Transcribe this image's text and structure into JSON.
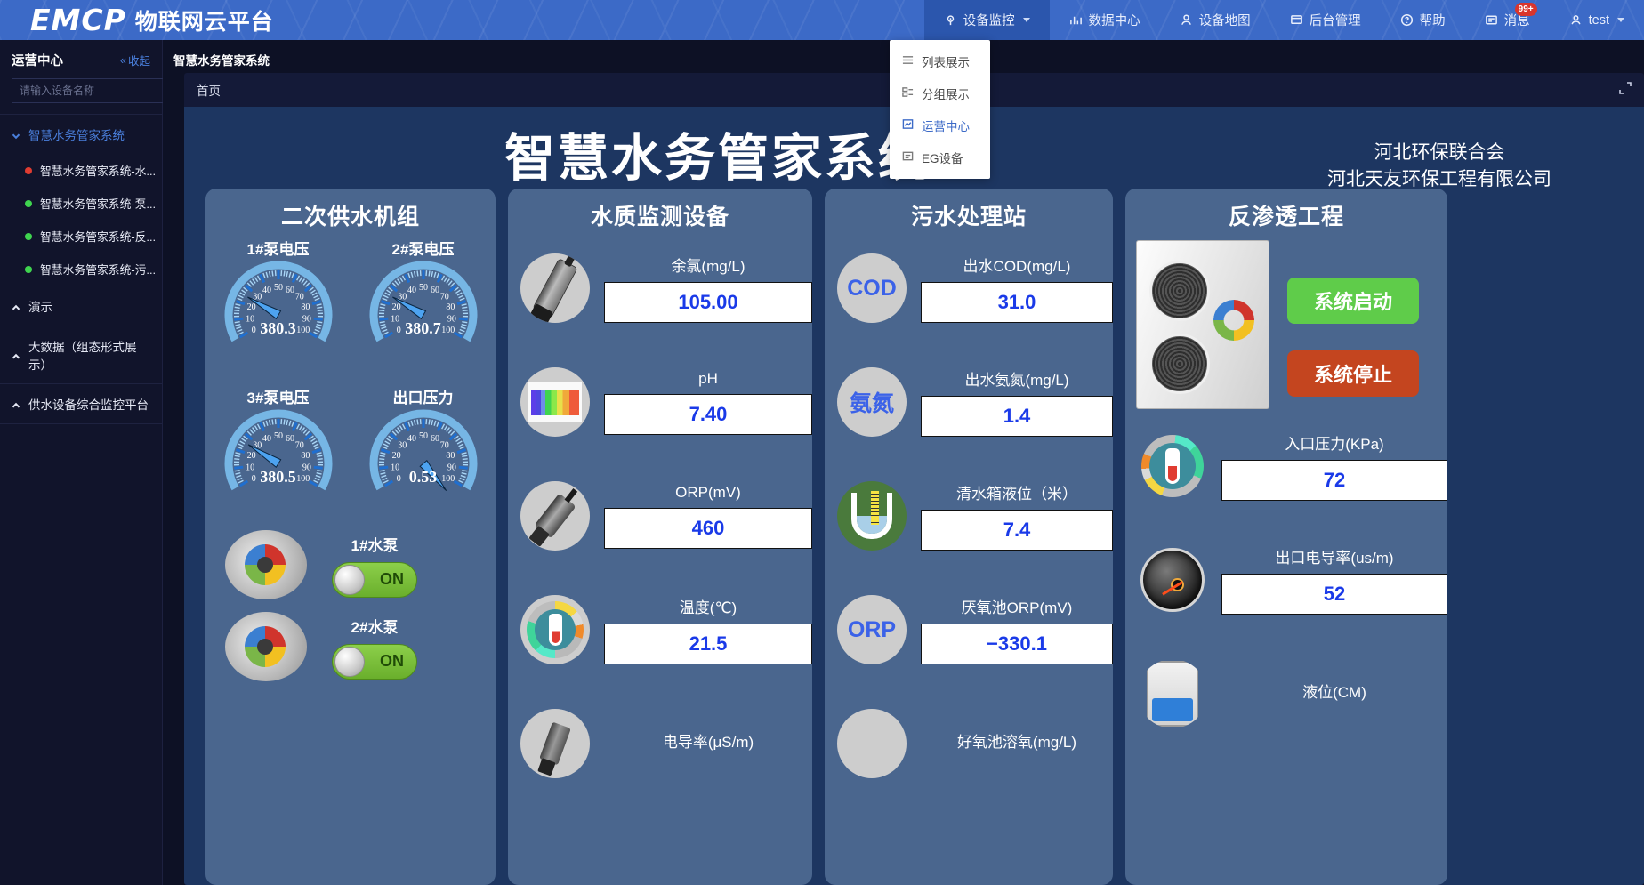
{
  "header": {
    "logo_text": "EMCP",
    "logo_cn": "物联网云平台",
    "nav": [
      {
        "label": "设备监控",
        "icon": "monitor-icon",
        "active": true,
        "caret": true
      },
      {
        "label": "数据中心",
        "icon": "chart-icon",
        "active": false,
        "caret": false
      },
      {
        "label": "设备地图",
        "icon": "map-pin-icon",
        "active": false,
        "caret": false
      },
      {
        "label": "后台管理",
        "icon": "admin-icon",
        "active": false,
        "caret": false
      },
      {
        "label": "帮助",
        "icon": "help-icon",
        "active": false,
        "caret": false
      },
      {
        "label": "消息",
        "icon": "message-icon",
        "active": false,
        "caret": false,
        "badge": "99+"
      },
      {
        "label": "test",
        "icon": "user-icon",
        "active": false,
        "caret": true
      }
    ]
  },
  "dropdown": {
    "items": [
      {
        "label": "列表展示",
        "icon": "list-icon",
        "selected": false
      },
      {
        "label": "分组展示",
        "icon": "group-icon",
        "selected": false
      },
      {
        "label": "运营中心",
        "icon": "dashboard-icon",
        "selected": true
      },
      {
        "label": "EG设备",
        "icon": "device-icon",
        "selected": false
      }
    ]
  },
  "sidebar": {
    "title": "运营中心",
    "collapse_label": "收起",
    "search_placeholder": "请输入设备名称",
    "tree": [
      {
        "type": "group",
        "label": "智慧水务管家系统",
        "expanded": true,
        "highlight": true
      },
      {
        "type": "leaf",
        "label": "智慧水务管家系统-水...",
        "status": "#e03c31"
      },
      {
        "type": "leaf",
        "label": "智慧水务管家系统-泵...",
        "status": "#3fd44f"
      },
      {
        "type": "leaf",
        "label": "智慧水务管家系统-反...",
        "status": "#3fd44f"
      },
      {
        "type": "leaf",
        "label": "智慧水务管家系统-污...",
        "status": "#3fd44f"
      },
      {
        "type": "group",
        "label": "演示",
        "expanded": false,
        "highlight": false
      },
      {
        "type": "group",
        "label": "大数据（组态形式展示）",
        "expanded": false,
        "highlight": false
      },
      {
        "type": "group",
        "label": "供水设备综合监控平台",
        "expanded": false,
        "highlight": false
      }
    ]
  },
  "page": {
    "title": "智慧水务管家系统",
    "tab": "首页"
  },
  "scada": {
    "main_title": "智慧水务管家系统",
    "corp_line1": "河北环保联合会",
    "corp_line2": "河北天友环保工程有限公司",
    "card1": {
      "title": "二次供水机组",
      "gauges": [
        {
          "label": "1#泵电压",
          "value": "380.3",
          "angle": 210
        },
        {
          "label": "2#泵电压",
          "value": "380.7",
          "angle": 210
        },
        {
          "label": "3#泵电压",
          "value": "380.5",
          "angle": 212
        },
        {
          "label": "出口压力",
          "value": "0.53",
          "angle": 50
        }
      ],
      "gauge_ticks": [
        "0",
        "10",
        "20",
        "30",
        "40",
        "50",
        "60",
        "70",
        "80",
        "90",
        "100"
      ],
      "pumps": [
        {
          "name": "1#水泵",
          "state": "ON"
        },
        {
          "name": "2#水泵",
          "state": "ON"
        }
      ]
    },
    "card2": {
      "title": "水质监测设备",
      "rows": [
        {
          "icon": "probe-sensor-icon",
          "label": "余氯(mg/L)",
          "value": "105.00"
        },
        {
          "icon": "ph-strip-icon",
          "label": "pH",
          "value": "7.40"
        },
        {
          "icon": "orp-sensor-icon",
          "label": "ORP(mV)",
          "value": "460"
        },
        {
          "icon": "thermometer-icon",
          "label": "温度(℃)",
          "value": "21.5"
        },
        {
          "icon": "conductivity-icon",
          "label": "电导率(μS/m)",
          "value": ""
        }
      ]
    },
    "card3": {
      "title": "污水处理站",
      "rows": [
        {
          "icon": "cod-badge-icon",
          "label": "出水COD(mg/L)",
          "value": "31.0"
        },
        {
          "icon": "ammonia-badge-icon",
          "label": "出水氨氮(mg/L)",
          "value": "1.4"
        },
        {
          "icon": "tank-level-icon",
          "label": "清水箱液位（米）",
          "value": "7.4"
        },
        {
          "icon": "orp-badge-icon",
          "label": "厌氧池ORP(mV)",
          "value": "−330.1"
        },
        {
          "icon": "oxygen-badge-icon",
          "label": "好氧池溶氧(mg/L)",
          "value": ""
        }
      ]
    },
    "card4": {
      "title": "反渗透工程",
      "start_label": "系统启动",
      "stop_label": "系统停止",
      "rows": [
        {
          "icon": "thermometer-dial-icon",
          "label": "入口压力(KPa)",
          "value": "72"
        },
        {
          "icon": "pressure-gauge-icon",
          "label": "出口电导率(us/m)",
          "value": "52"
        },
        {
          "icon": "water-tank-icon",
          "label": "液位(CM)",
          "value": ""
        }
      ]
    }
  },
  "colors": {
    "accent": "#3c6ac7",
    "panel_bg": "#4a668e",
    "scada_bg": "#1d3661",
    "value_blue": "#1a3ae8",
    "start_green": "#5fcc4a",
    "stop_red": "#c4451f"
  }
}
